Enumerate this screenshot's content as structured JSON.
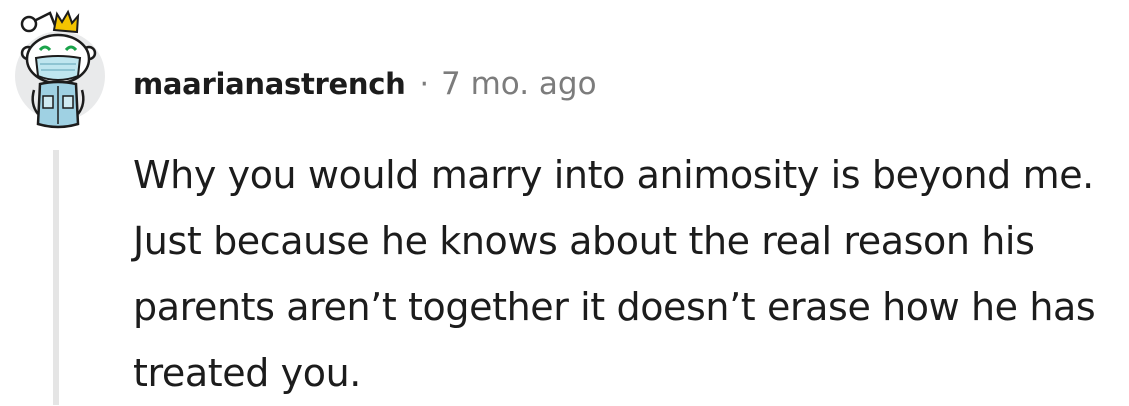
{
  "comment": {
    "author": "maarianastrench",
    "separator": "·",
    "timestamp": "7 mo. ago",
    "body": "Why you would marry into animosity is beyond me. Just because he knows about the real reason his parents aren’t together it doesn’t erase how he has treated you."
  },
  "avatar": {
    "icon": "reddit-snoo-avatar-icon",
    "colors": {
      "background": "#e9eaeb",
      "crown": "#f4c400",
      "mask": "#bfe6ef",
      "shirt": "#9fd1e3",
      "outline": "#1c1c1c"
    }
  },
  "thread": {
    "line_color": "#e5e5e5"
  }
}
